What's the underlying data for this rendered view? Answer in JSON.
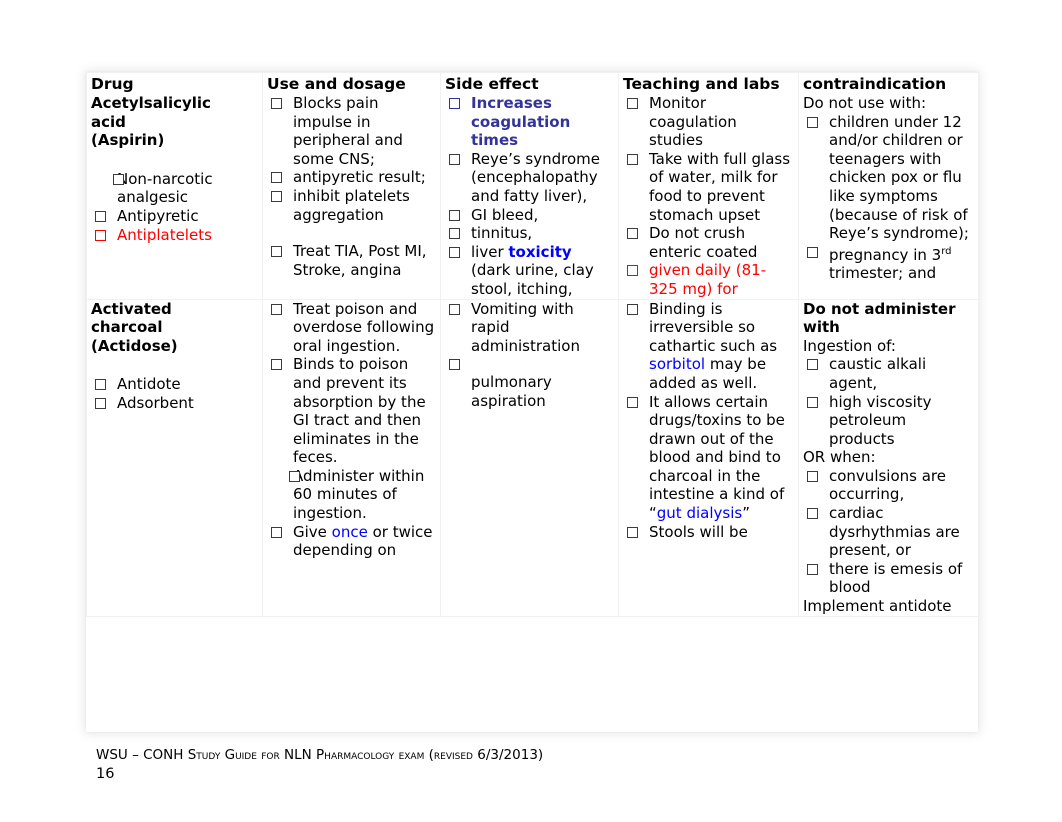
{
  "document": {
    "footer_text": "WSU – CONH Study Guide for NLN Pharmacology exam (revised 6/3/2013)",
    "page_number": "16"
  },
  "colors": {
    "red": "#FF0000",
    "dark_red": "#C00000",
    "blue": "#0000FF",
    "navy": "#333399",
    "text": "#000000",
    "border": "#F1F1F1"
  },
  "table": {
    "headers": {
      "drug": "Drug",
      "use": "Use and dosage",
      "side_effect": "Side effect",
      "teaching": "Teaching and labs",
      "contraindication": "contraindication"
    },
    "rows": [
      {
        "drug": {
          "name_line1": "Acetylsalicylic",
          "name_line2": "acid",
          "name_line3": "(Aspirin)",
          "items": [
            {
              "text": "Non-narcotic analgesic",
              "indent": true,
              "color": "black"
            },
            {
              "text": "Antipyretic",
              "indent": false,
              "color": "black"
            },
            {
              "text": "Antiplatelets",
              "indent": false,
              "color": "red"
            }
          ]
        },
        "use": {
          "items": [
            {
              "text": "Blocks pain impulse in peripheral and some CNS;",
              "hang": true
            },
            {
              "text": "antipyretic result;",
              "hang": false
            },
            {
              "text": "inhibit platelets aggregation",
              "hang": false
            },
            {
              "text": "",
              "spacer": true
            },
            {
              "text": "Treat TIA, Post MI, Stroke, angina",
              "hang": true
            }
          ]
        },
        "side_effect": {
          "items": [
            {
              "text": "Increases coagulation times",
              "style": "navy-bold"
            },
            {
              "text": "Reye’s syndrome (encephalopathy and fatty liver),",
              "style": "plain"
            },
            {
              "text": "GI bleed,",
              "style": "plain"
            },
            {
              "text": "tinnitus,",
              "style": "plain"
            },
            {
              "text": "liver toxicity (dark urine, clay stool, itching,",
              "style": "mixed-toxicity",
              "pre": "liver ",
              "em": "toxicity",
              "post": " (dark urine, clay stool, itching,"
            }
          ]
        },
        "teaching": {
          "items": [
            {
              "text": "Monitor coagulation studies",
              "style": "plain"
            },
            {
              "text": "Take with full glass of water, milk for food to prevent stomach upset",
              "style": "plain"
            },
            {
              "text": "Do not crush enteric coated",
              "style": "plain"
            },
            {
              "text": "given daily (81-325 mg) for",
              "style": "red"
            }
          ]
        },
        "contraindication": {
          "lead": "Do not use with:",
          "items": [
            {
              "text": "children under 12 and/or children or teenagers with chicken pox or flu like symptoms (because of risk of Reye’s syndrome);",
              "style": "plain"
            },
            {
              "text": "pregnancy in 3 rd trimester; and",
              "style": "ordinal",
              "num": "3",
              "ord": "rd",
              "pre": "pregnancy in ",
              "post": " trimester; and"
            }
          ]
        }
      },
      {
        "drug": {
          "name_line1": "Activated",
          "name_line2": "charcoal",
          "name_line3": "(Actidose)",
          "items": [
            {
              "text": "Antidote",
              "indent": false,
              "color": "black"
            },
            {
              "text": "Adsorbent",
              "indent": false,
              "color": "black"
            }
          ]
        },
        "use": {
          "items": [
            {
              "text": "Treat poison and overdose following oral ingestion.",
              "hang": true
            },
            {
              "text": "Binds to poison and prevent its absorption by the GI tract and then eliminates in the feces.",
              "hang": true
            },
            {
              "text": "Administer within 60 minutes of ingestion.",
              "hang": true,
              "inset": true
            },
            {
              "text": "Give once or twice depending on",
              "hang": true,
              "style": "mixed-once",
              "pre": "Give ",
              "em": "once",
              "post": " or twice depending on"
            }
          ]
        },
        "side_effect": {
          "items": [
            {
              "text": "Vomiting with rapid administration",
              "style": "plain"
            },
            {
              "text": "pulmonary aspiration",
              "style": "plain",
              "gap": true
            }
          ]
        },
        "teaching": {
          "items": [
            {
              "text": "Binding is irreversible so cathartic such as sorbitol may be added as well.",
              "style": "mixed-sorbitol",
              "pre": "Binding is irreversible so cathartic such as ",
              "em": "sorbitol",
              "post": " may be added as well."
            },
            {
              "text": "It allows certain drugs/toxins to be drawn out of the blood and bind to charcoal in the intestine a kind of “gut dialysis”",
              "style": "mixed-gut",
              "pre": "It allows certain drugs/toxins to be drawn out of the blood and bind to charcoal in the intestine a kind of “",
              "em": "gut dialysis",
              "post": "”"
            },
            {
              "text": "Stools will be",
              "style": "plain"
            }
          ]
        },
        "contraindication": {
          "heading": "Do not administer with",
          "lead": "Ingestion of:",
          "items": [
            {
              "text": "caustic alkali agent,",
              "style": "plain"
            },
            {
              "text": "high viscosity petroleum products",
              "style": "plain"
            }
          ],
          "lead2": "OR when:",
          "items2": [
            {
              "text": "convulsions are occurring,",
              "style": "plain"
            },
            {
              "text": "cardiac dysrhythmias are present, or",
              "style": "plain"
            },
            {
              "text": "there is emesis of blood",
              "style": "plain"
            }
          ],
          "tail": "Implement antidote"
        }
      }
    ]
  }
}
